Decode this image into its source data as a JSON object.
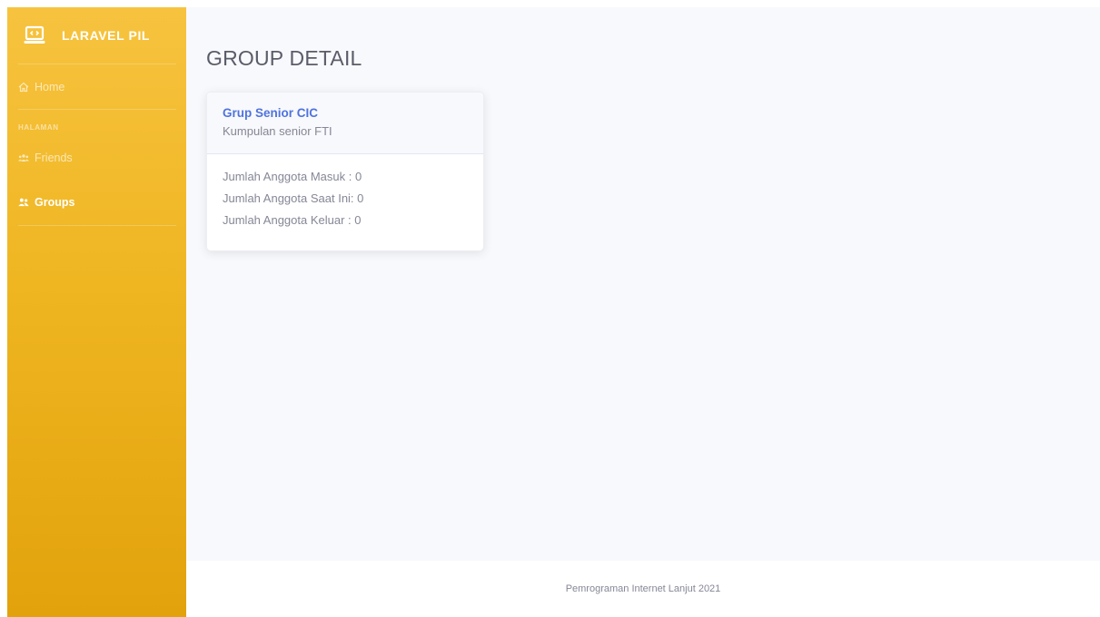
{
  "sidebar": {
    "brand": {
      "text": "LARAVEL PIL",
      "icon": "laptop-code-icon"
    },
    "items": [
      {
        "label": "Home",
        "icon": "home-icon"
      },
      {
        "label": "Friends",
        "icon": "users-icon"
      },
      {
        "label": "Groups",
        "icon": "user-group-icon"
      }
    ],
    "section_heading": "HALAMAN",
    "active_item": "Groups"
  },
  "main": {
    "page_title": "GROUP DETAIL",
    "group": {
      "name": "Grup Senior CIC",
      "description": "Kumpulan senior FTI",
      "stats": [
        "Jumlah Anggota Masuk : 0",
        "Jumlah Anggota Saat Ini: 0",
        "Jumlah Anggota Keluar : 0"
      ]
    }
  },
  "footer": {
    "text": "Pemrograman Internet Lanjut 2021"
  },
  "colors": {
    "sidebar_top": "#f7c33f",
    "sidebar_bottom": "#e2a20c",
    "accent": "#4e73df",
    "text_muted": "#858796",
    "content_bg": "#f8f9fc"
  }
}
